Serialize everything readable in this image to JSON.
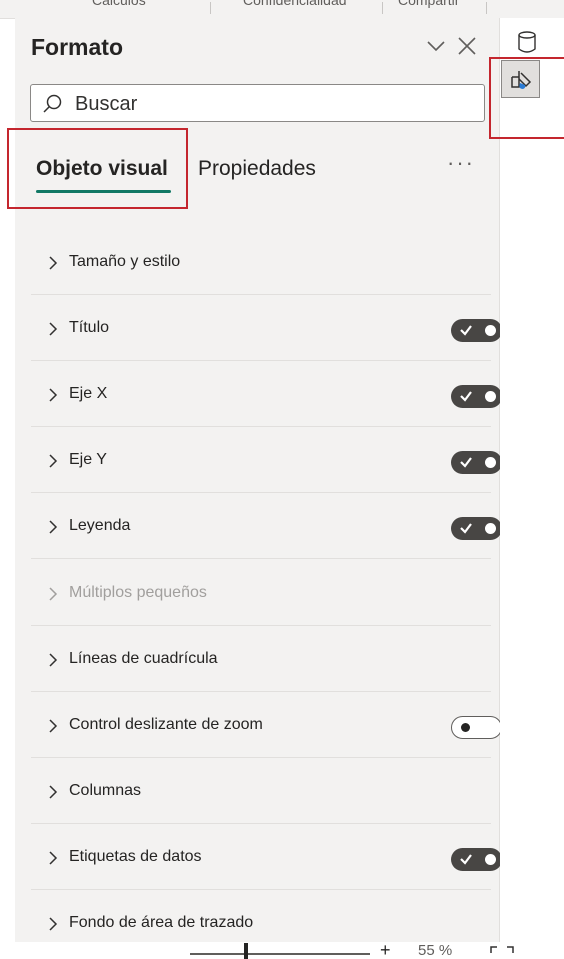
{
  "ribbon": {
    "tabs": [
      "Cálculos",
      "Confidencialidad",
      "Compartir"
    ]
  },
  "pane": {
    "title": "Formato",
    "search_placeholder": "Buscar",
    "tabs": [
      {
        "label": "Objeto visual",
        "selected": true
      },
      {
        "label": "Propiedades",
        "selected": false
      }
    ],
    "more_label": "···",
    "sections": [
      {
        "label": "Tamaño y estilo",
        "toggle": null,
        "disabled": false
      },
      {
        "label": "Título",
        "toggle": "on",
        "disabled": false
      },
      {
        "label": "Eje X",
        "toggle": "on",
        "disabled": false
      },
      {
        "label": "Eje Y",
        "toggle": "on",
        "disabled": false
      },
      {
        "label": "Leyenda",
        "toggle": "on",
        "disabled": false
      },
      {
        "label": "Múltiplos pequeños",
        "toggle": null,
        "disabled": true
      },
      {
        "label": "Líneas de cuadrícula",
        "toggle": null,
        "disabled": false
      },
      {
        "label": "Control deslizante de zoom",
        "toggle": "off",
        "disabled": false
      },
      {
        "label": "Columnas",
        "toggle": null,
        "disabled": false
      },
      {
        "label": "Etiquetas de datos",
        "toggle": "on",
        "disabled": false
      },
      {
        "label": "Fondo de área de trazado",
        "toggle": null,
        "disabled": false
      }
    ]
  },
  "rail": {
    "icons": [
      "data-icon",
      "format-visual-icon"
    ]
  },
  "status": {
    "zoom_plus": "+",
    "zoom_percent": "55 %"
  },
  "colors": {
    "accent_underline": "#117865",
    "highlight": "#c4262e",
    "pane_bg": "#f3f2f1",
    "toggle_on": "#484644"
  }
}
